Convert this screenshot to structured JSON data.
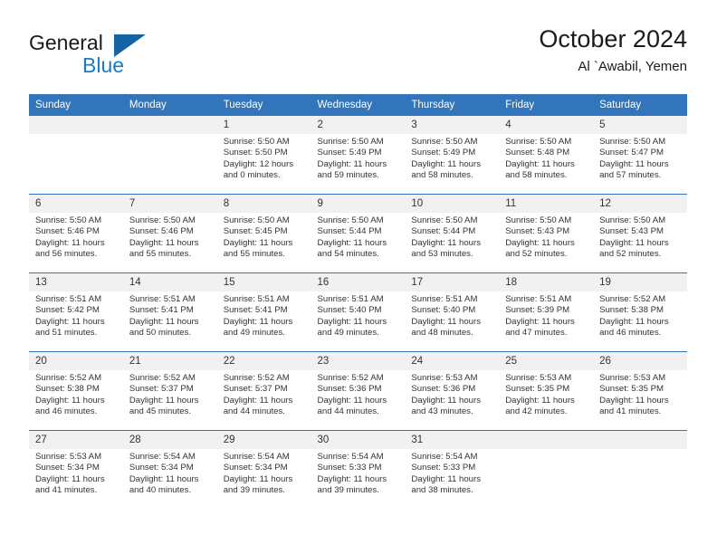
{
  "brand": {
    "word1": "General",
    "word2": "Blue",
    "accent_color": "#1464a5",
    "blue_text_color": "#1a7bc4"
  },
  "header": {
    "title": "October 2024",
    "location": "Al `Awabil, Yemen"
  },
  "calendar": {
    "header_color": "#3275bb",
    "daynum_band_color": "#f1f1f1",
    "weekday_headers": [
      "Sunday",
      "Monday",
      "Tuesday",
      "Wednesday",
      "Thursday",
      "Friday",
      "Saturday"
    ],
    "weeks": [
      [
        {
          "day": "",
          "empty": true
        },
        {
          "day": "",
          "empty": true
        },
        {
          "day": "1",
          "sunrise": "Sunrise: 5:50 AM",
          "sunset": "Sunset: 5:50 PM",
          "daylight": "Daylight: 12 hours and 0 minutes."
        },
        {
          "day": "2",
          "sunrise": "Sunrise: 5:50 AM",
          "sunset": "Sunset: 5:49 PM",
          "daylight": "Daylight: 11 hours and 59 minutes."
        },
        {
          "day": "3",
          "sunrise": "Sunrise: 5:50 AM",
          "sunset": "Sunset: 5:49 PM",
          "daylight": "Daylight: 11 hours and 58 minutes."
        },
        {
          "day": "4",
          "sunrise": "Sunrise: 5:50 AM",
          "sunset": "Sunset: 5:48 PM",
          "daylight": "Daylight: 11 hours and 58 minutes."
        },
        {
          "day": "5",
          "sunrise": "Sunrise: 5:50 AM",
          "sunset": "Sunset: 5:47 PM",
          "daylight": "Daylight: 11 hours and 57 minutes."
        }
      ],
      [
        {
          "day": "6",
          "sunrise": "Sunrise: 5:50 AM",
          "sunset": "Sunset: 5:46 PM",
          "daylight": "Daylight: 11 hours and 56 minutes."
        },
        {
          "day": "7",
          "sunrise": "Sunrise: 5:50 AM",
          "sunset": "Sunset: 5:46 PM",
          "daylight": "Daylight: 11 hours and 55 minutes."
        },
        {
          "day": "8",
          "sunrise": "Sunrise: 5:50 AM",
          "sunset": "Sunset: 5:45 PM",
          "daylight": "Daylight: 11 hours and 55 minutes."
        },
        {
          "day": "9",
          "sunrise": "Sunrise: 5:50 AM",
          "sunset": "Sunset: 5:44 PM",
          "daylight": "Daylight: 11 hours and 54 minutes."
        },
        {
          "day": "10",
          "sunrise": "Sunrise: 5:50 AM",
          "sunset": "Sunset: 5:44 PM",
          "daylight": "Daylight: 11 hours and 53 minutes."
        },
        {
          "day": "11",
          "sunrise": "Sunrise: 5:50 AM",
          "sunset": "Sunset: 5:43 PM",
          "daylight": "Daylight: 11 hours and 52 minutes."
        },
        {
          "day": "12",
          "sunrise": "Sunrise: 5:50 AM",
          "sunset": "Sunset: 5:43 PM",
          "daylight": "Daylight: 11 hours and 52 minutes."
        }
      ],
      [
        {
          "day": "13",
          "sunrise": "Sunrise: 5:51 AM",
          "sunset": "Sunset: 5:42 PM",
          "daylight": "Daylight: 11 hours and 51 minutes."
        },
        {
          "day": "14",
          "sunrise": "Sunrise: 5:51 AM",
          "sunset": "Sunset: 5:41 PM",
          "daylight": "Daylight: 11 hours and 50 minutes."
        },
        {
          "day": "15",
          "sunrise": "Sunrise: 5:51 AM",
          "sunset": "Sunset: 5:41 PM",
          "daylight": "Daylight: 11 hours and 49 minutes."
        },
        {
          "day": "16",
          "sunrise": "Sunrise: 5:51 AM",
          "sunset": "Sunset: 5:40 PM",
          "daylight": "Daylight: 11 hours and 49 minutes."
        },
        {
          "day": "17",
          "sunrise": "Sunrise: 5:51 AM",
          "sunset": "Sunset: 5:40 PM",
          "daylight": "Daylight: 11 hours and 48 minutes."
        },
        {
          "day": "18",
          "sunrise": "Sunrise: 5:51 AM",
          "sunset": "Sunset: 5:39 PM",
          "daylight": "Daylight: 11 hours and 47 minutes."
        },
        {
          "day": "19",
          "sunrise": "Sunrise: 5:52 AM",
          "sunset": "Sunset: 5:38 PM",
          "daylight": "Daylight: 11 hours and 46 minutes."
        }
      ],
      [
        {
          "day": "20",
          "sunrise": "Sunrise: 5:52 AM",
          "sunset": "Sunset: 5:38 PM",
          "daylight": "Daylight: 11 hours and 46 minutes."
        },
        {
          "day": "21",
          "sunrise": "Sunrise: 5:52 AM",
          "sunset": "Sunset: 5:37 PM",
          "daylight": "Daylight: 11 hours and 45 minutes."
        },
        {
          "day": "22",
          "sunrise": "Sunrise: 5:52 AM",
          "sunset": "Sunset: 5:37 PM",
          "daylight": "Daylight: 11 hours and 44 minutes."
        },
        {
          "day": "23",
          "sunrise": "Sunrise: 5:52 AM",
          "sunset": "Sunset: 5:36 PM",
          "daylight": "Daylight: 11 hours and 44 minutes."
        },
        {
          "day": "24",
          "sunrise": "Sunrise: 5:53 AM",
          "sunset": "Sunset: 5:36 PM",
          "daylight": "Daylight: 11 hours and 43 minutes."
        },
        {
          "day": "25",
          "sunrise": "Sunrise: 5:53 AM",
          "sunset": "Sunset: 5:35 PM",
          "daylight": "Daylight: 11 hours and 42 minutes."
        },
        {
          "day": "26",
          "sunrise": "Sunrise: 5:53 AM",
          "sunset": "Sunset: 5:35 PM",
          "daylight": "Daylight: 11 hours and 41 minutes."
        }
      ],
      [
        {
          "day": "27",
          "sunrise": "Sunrise: 5:53 AM",
          "sunset": "Sunset: 5:34 PM",
          "daylight": "Daylight: 11 hours and 41 minutes."
        },
        {
          "day": "28",
          "sunrise": "Sunrise: 5:54 AM",
          "sunset": "Sunset: 5:34 PM",
          "daylight": "Daylight: 11 hours and 40 minutes."
        },
        {
          "day": "29",
          "sunrise": "Sunrise: 5:54 AM",
          "sunset": "Sunset: 5:34 PM",
          "daylight": "Daylight: 11 hours and 39 minutes."
        },
        {
          "day": "30",
          "sunrise": "Sunrise: 5:54 AM",
          "sunset": "Sunset: 5:33 PM",
          "daylight": "Daylight: 11 hours and 39 minutes."
        },
        {
          "day": "31",
          "sunrise": "Sunrise: 5:54 AM",
          "sunset": "Sunset: 5:33 PM",
          "daylight": "Daylight: 11 hours and 38 minutes."
        },
        {
          "day": "",
          "empty": true
        },
        {
          "day": "",
          "empty": true
        }
      ]
    ]
  }
}
